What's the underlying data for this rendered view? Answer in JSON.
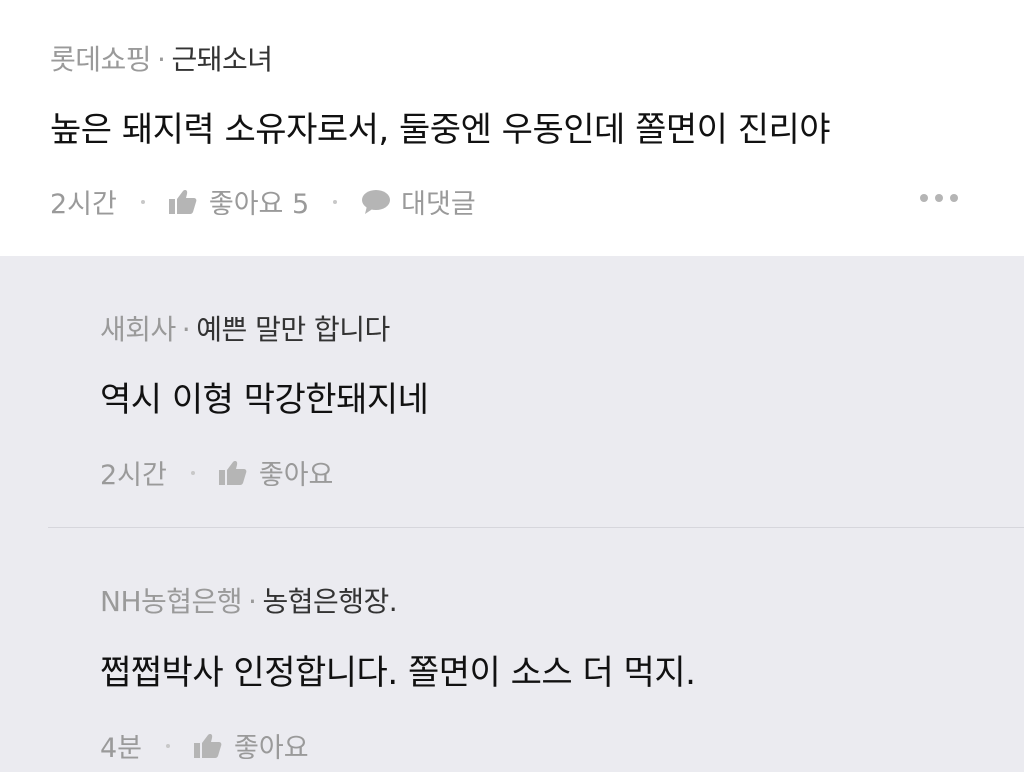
{
  "top_comment": {
    "store": "롯데쇼핑",
    "separator": "·",
    "nickname": "근돼소녀",
    "text": "높은 돼지력 소유자로서, 둘중엔 우동인데 쫄면이 진리야",
    "time": "2시간",
    "like_label": "좋아요 5",
    "reply_label": "대댓글",
    "icons": {
      "like": "thumbs-up-icon",
      "reply": "speech-bubble-icon",
      "more": "more-dots-icon"
    }
  },
  "replies": [
    {
      "store": "새회사",
      "separator": "·",
      "nickname": "예쁜 말만 합니다",
      "text": "역시 이형 막강한돼지네",
      "time": "2시간",
      "like_label": "좋아요"
    },
    {
      "store": "NH농협은행",
      "separator": "·",
      "nickname": "농협은행장.",
      "text": "쩝쩝박사 인정합니다. 쫄면이 소스 더 먹지.",
      "time": "4분",
      "like_label": "좋아요"
    }
  ],
  "colors": {
    "reply_background": "#ebebf0",
    "meta_gray": "#9a9a9a",
    "text": "#111111"
  }
}
